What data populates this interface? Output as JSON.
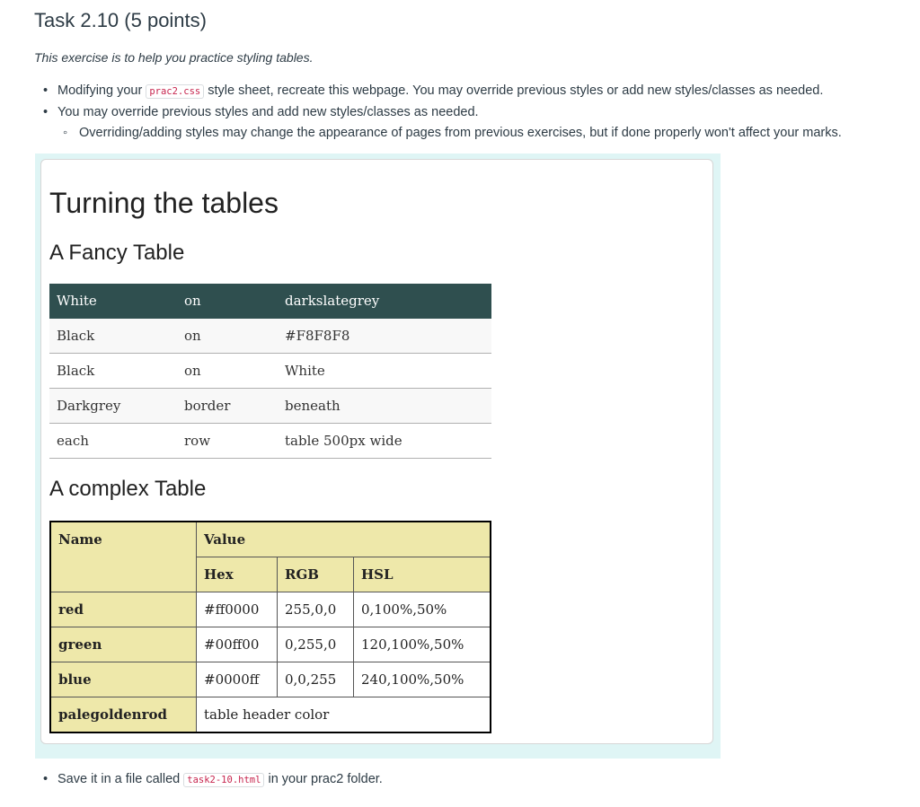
{
  "task_title": "Task 2.10 (5 points)",
  "intro": "This exercise is to help you practice styling tables.",
  "bullets": [
    {
      "before": "Modifying your ",
      "code": "prac2.css",
      "after": " style sheet, recreate this webpage. You may override previous styles or add new styles/classes as needed."
    },
    {
      "text": "You may override previous styles and add new styles/classes as needed."
    },
    {
      "text": "Overriding/adding styles may change the appearance of pages from previous exercises, but if done properly won't affect your marks."
    }
  ],
  "example": {
    "heading": "Turning the tables",
    "fancy_heading": "A Fancy Table",
    "fancy_rows": [
      [
        "White",
        "on",
        "darkslategrey"
      ],
      [
        "Black",
        "on",
        "#F8F8F8"
      ],
      [
        "Black",
        "on",
        "White"
      ],
      [
        "Darkgrey",
        "border",
        "beneath"
      ],
      [
        "each",
        "row",
        "table 500px wide"
      ]
    ],
    "complex_heading": "A complex Table",
    "complex": {
      "name_header": "Name",
      "value_header": "Value",
      "sub_headers": [
        "Hex",
        "RGB",
        "HSL"
      ],
      "rows": [
        {
          "name": "red",
          "hex": "#ff0000",
          "rgb": "255,0,0",
          "hsl": "0,100%,50%"
        },
        {
          "name": "green",
          "hex": "#00ff00",
          "rgb": "0,255,0",
          "hsl": "120,100%,50%"
        },
        {
          "name": "blue",
          "hex": "#0000ff",
          "rgb": "0,0,255",
          "hsl": "240,100%,50%"
        }
      ],
      "last_row": {
        "name": "palegoldenrod",
        "value": "table header color"
      }
    },
    "colors": {
      "header_dark": "#2f4f4f",
      "alt_row": "#f8f8f8",
      "complex_header": "#eee8aa",
      "frame": "#dff5f5"
    }
  },
  "save": {
    "before": "Save it in a file called ",
    "code": "task2-10.html",
    "after": " in your prac2 folder."
  }
}
